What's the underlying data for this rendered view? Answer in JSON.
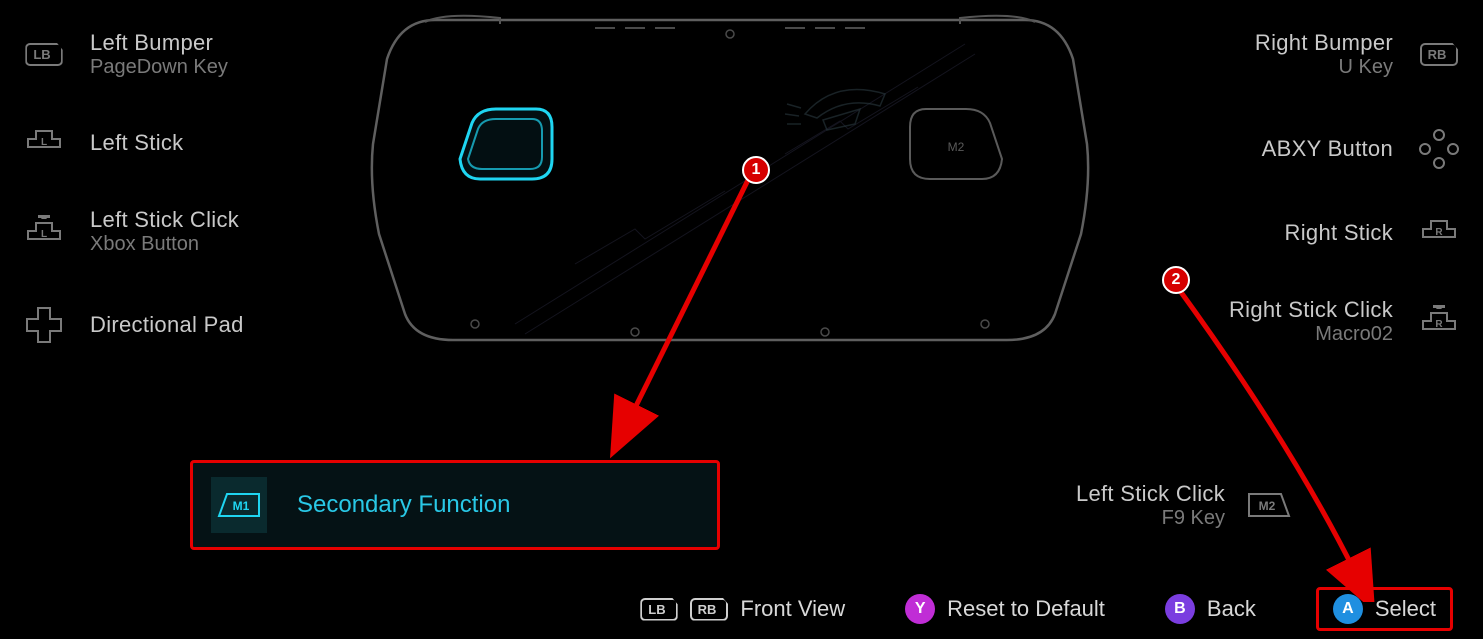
{
  "left": [
    {
      "primary": "Left Bumper",
      "secondary": "PageDown Key",
      "icon": "LB"
    },
    {
      "primary": "Left Stick",
      "secondary": "",
      "icon": "L-stick"
    },
    {
      "primary": "Left Stick Click",
      "secondary": "Xbox Button",
      "icon": "L-click"
    },
    {
      "primary": "Directional Pad",
      "secondary": "",
      "icon": "dpad"
    }
  ],
  "right": [
    {
      "primary": "Right Bumper",
      "secondary": "U Key",
      "icon": "RB"
    },
    {
      "primary": "ABXY Button",
      "secondary": "",
      "icon": "abxy"
    },
    {
      "primary": "Right Stick",
      "secondary": "",
      "icon": "R-stick"
    },
    {
      "primary": "Right Stick Click",
      "secondary": "Macro02",
      "icon": "R-click"
    }
  ],
  "selected": {
    "icon": "M1",
    "label": "Secondary Function"
  },
  "m2": {
    "primary": "Left Stick Click",
    "secondary": "F9 Key",
    "icon": "M2"
  },
  "footer": {
    "view": {
      "LB": "LB",
      "RB": "RB",
      "label": "Front View"
    },
    "reset": {
      "btn": "Y",
      "label": "Reset to Default"
    },
    "back": {
      "btn": "B",
      "label": "Back"
    },
    "select": {
      "btn": "A",
      "label": "Select"
    }
  },
  "markers": {
    "one": "1",
    "two": "2"
  }
}
